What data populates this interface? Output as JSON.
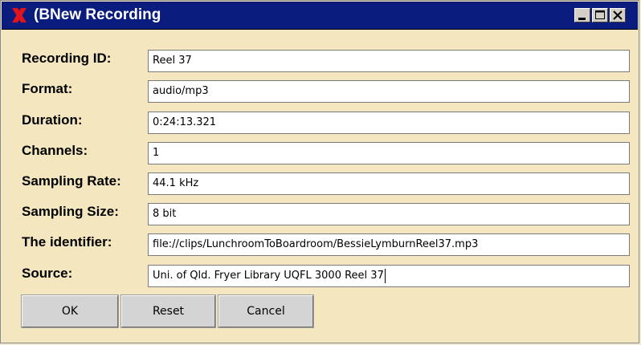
{
  "window": {
    "title": "(BNew Recording",
    "icon": "x-logo-icon",
    "controls": [
      "minimize-icon",
      "maximize-icon",
      "close-icon"
    ]
  },
  "form": {
    "fields": [
      {
        "label": "Recording ID:",
        "value": "Reel 37"
      },
      {
        "label": "Format:",
        "value": "audio/mp3"
      },
      {
        "label": "Duration:",
        "value": "0:24:13.321"
      },
      {
        "label": "Channels:",
        "value": "1"
      },
      {
        "label": "Sampling Rate:",
        "value": "44.1 kHz"
      },
      {
        "label": "Sampling Size:",
        "value": "8 bit"
      },
      {
        "label": "The identifier:",
        "value": "file://clips/LunchroomToBoardroom/BessieLymburnReel37.mp3"
      },
      {
        "label": "Source:",
        "value": "Uni. of Qld. Fryer Library UQFL 3000 Reel 37"
      }
    ]
  },
  "buttons": {
    "ok": "OK",
    "reset": "Reset",
    "cancel": "Cancel"
  },
  "colors": {
    "titlebar": "#0a1c7e",
    "dialog_background": "#f4e7bf",
    "icon_red": "#e0141e"
  }
}
